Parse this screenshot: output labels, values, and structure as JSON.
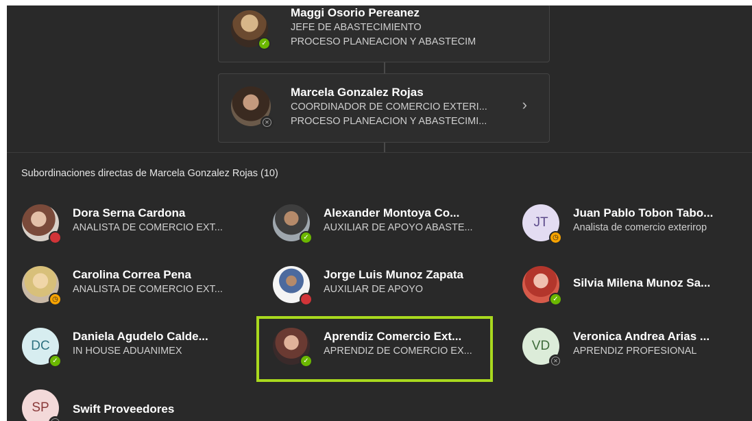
{
  "chain": [
    {
      "name": "Maggi Osorio Pereanez",
      "title": "JEFE DE ABASTECIMIENTO",
      "department": "PROCESO PLANEACION Y ABASTECIM",
      "status": "available"
    },
    {
      "name": "Marcela Gonzalez Rojas",
      "title": "COORDINADOR DE COMERCIO EXTERI...",
      "department": "PROCESO PLANEACION Y ABASTECIMI...",
      "status": "offline",
      "chevron": "›"
    }
  ],
  "reports": {
    "heading": "Subordinaciones directas de Marcela Gonzalez Rojas (10)",
    "people": [
      {
        "name": "Dora Serna Cardona",
        "title": "ANALISTA DE COMERCIO EXT...",
        "status": "busy"
      },
      {
        "name": "Alexander Montoya Co...",
        "title": "AUXILIAR DE APOYO ABASTE...",
        "status": "available"
      },
      {
        "name": "Juan Pablo Tobon Tabo...",
        "title": "Analista de comercio exterirор",
        "initials": "JT",
        "status": "away"
      },
      {
        "name": "Carolina Correa Pena",
        "title": "ANALISTA DE COMERCIO EXT...",
        "status": "away"
      },
      {
        "name": "Jorge Luis Munoz Zapata",
        "title": "AUXILIAR DE APOYO",
        "status": "busy"
      },
      {
        "name": "Silvia Milena Munoz Sa...",
        "title": "",
        "status": "available"
      },
      {
        "name": "Daniela Agudelo Calde...",
        "title": "IN HOUSE ADUANIMEX",
        "initials": "DC",
        "status": "available"
      },
      {
        "name": "Aprendiz Comercio Ext...",
        "title": "APRENDIZ DE COMERCIO EX...",
        "status": "available"
      },
      {
        "name": "Veronica Andrea Arias ...",
        "title": "APRENDIZ PROFESIONAL",
        "initials": "VD",
        "status": "offline"
      },
      {
        "name": "Swift Proveedores",
        "title": "",
        "initials": "SP",
        "status": "offline"
      }
    ]
  },
  "icons": {
    "available": "check-icon",
    "away": "clock-icon",
    "busy": "busy-dot-icon",
    "offline": "offline-x-icon"
  },
  "colors": {
    "background": "#292929",
    "available": "#6bb700",
    "busy": "#d13438",
    "away": "#f8a300",
    "highlight": "#a9d91e"
  }
}
